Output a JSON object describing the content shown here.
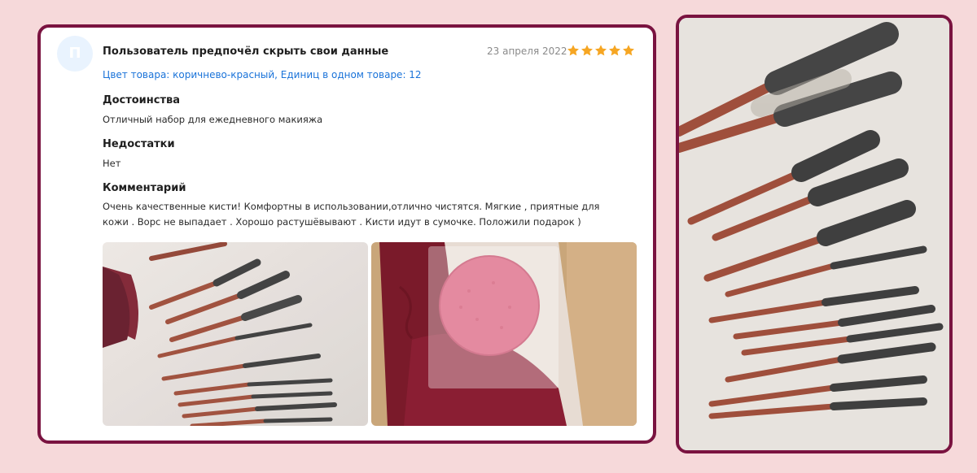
{
  "review": {
    "avatar_letter": "П",
    "author": "Пользователь предпочёл скрыть свои данные",
    "date": "23 апреля 2022",
    "rating": 5,
    "variant": "Цвет товара: коричнево-красный, Единиц в одном товаре: 12",
    "advantages_title": "Достоинства",
    "advantages_text": "Отличный набор для ежедневного макияжа",
    "disadvantages_title": "Недостатки",
    "disadvantages_text": "Нет",
    "comment_title": "Комментарий",
    "comment_text": "Очень качественные кисти! Комфортны в использовании,отлично чистятся. Мягкие , приятные для кожи . Ворс не выпадает . Хорошо растушёвывают . Кисти идут в сумочке. Положили подарок )"
  },
  "colors": {
    "brand_border": "#7a1340",
    "background": "#f6d9da",
    "star": "#f6a623",
    "link": "#1a73d9"
  },
  "photos": [
    {
      "name": "review-photo-brushes"
    },
    {
      "name": "review-photo-sponge"
    },
    {
      "name": "product-photo-brushes-large"
    }
  ]
}
